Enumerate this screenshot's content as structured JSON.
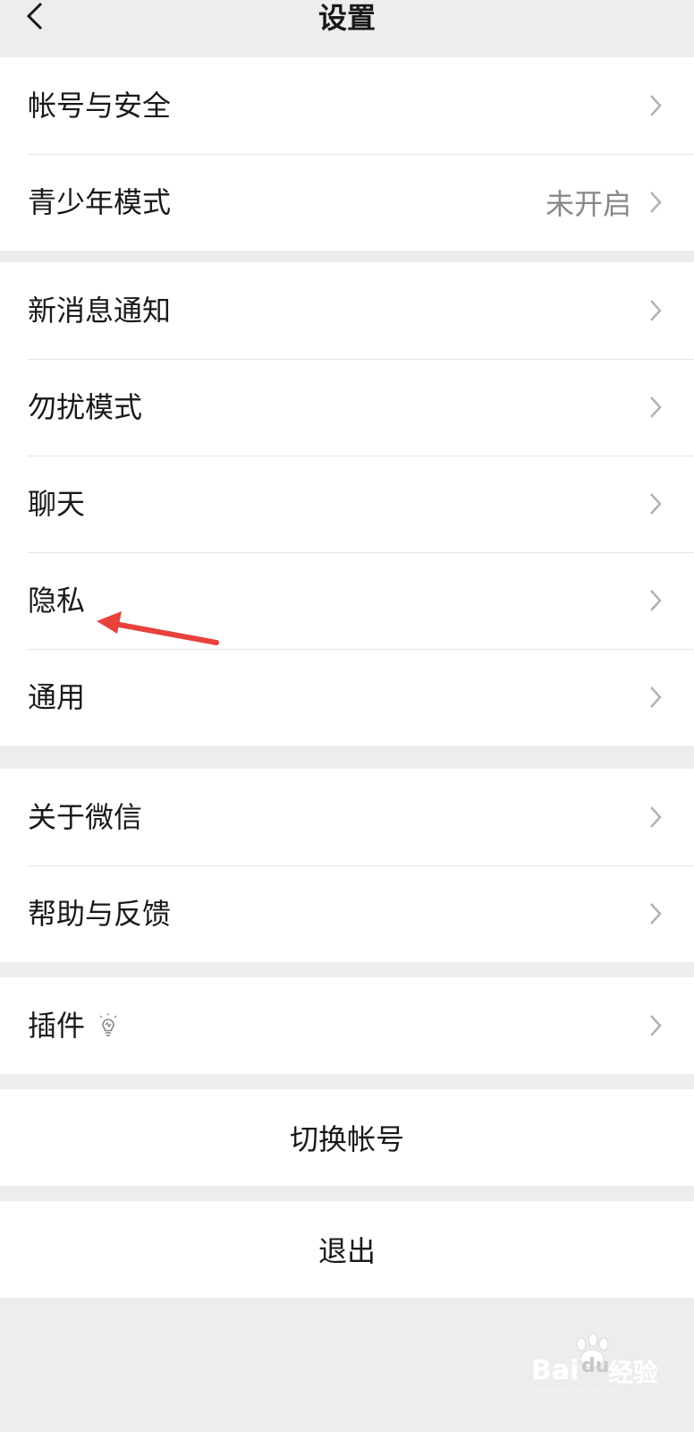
{
  "nav": {
    "title": "设置"
  },
  "group1": [
    {
      "label": "帐号与安全",
      "value": ""
    },
    {
      "label": "青少年模式",
      "value": "未开启"
    }
  ],
  "group2": [
    {
      "label": "新消息通知"
    },
    {
      "label": "勿扰模式"
    },
    {
      "label": "聊天"
    },
    {
      "label": "隐私"
    },
    {
      "label": "通用"
    }
  ],
  "group3": [
    {
      "label": "关于微信"
    },
    {
      "label": "帮助与反馈"
    }
  ],
  "group4": [
    {
      "label": "插件"
    }
  ],
  "switch_account": "切换帐号",
  "logout": "退出",
  "watermark": {
    "brand": "Bai",
    "brand2": "du",
    "cn": "经验",
    "url": "jingyan.baidu.com"
  },
  "colors": {
    "background": "#ededed",
    "row": "#ffffff",
    "text": "#191919",
    "secondary": "#888888",
    "arrow": "#e8413e"
  }
}
